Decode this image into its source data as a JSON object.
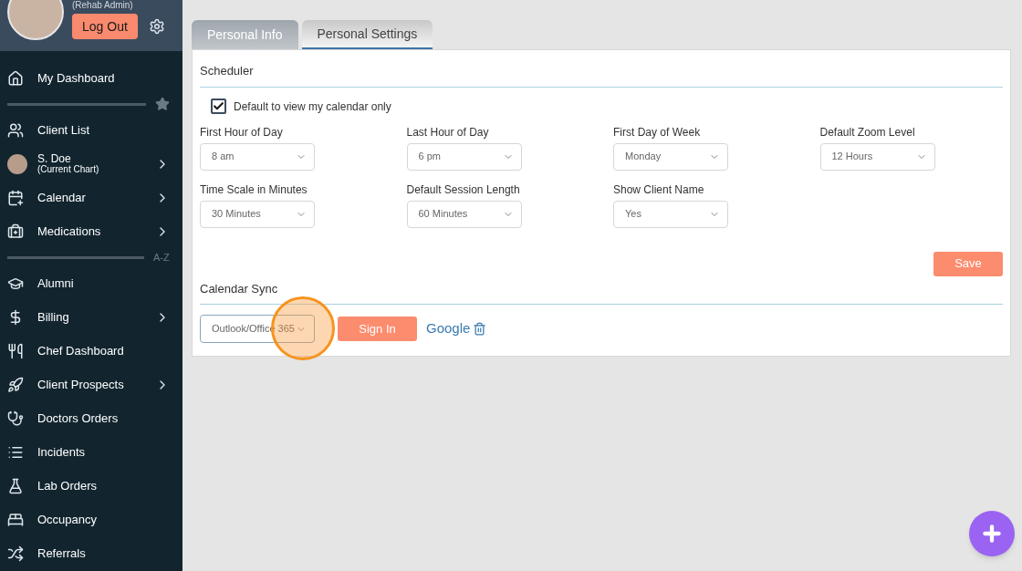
{
  "user": {
    "role": "(Rehab Admin)",
    "logout": "Log Out"
  },
  "sidebar": {
    "items": [
      {
        "kind": "link",
        "label": "My Dashboard",
        "has_submenu": false
      },
      {
        "kind": "divider"
      },
      {
        "kind": "link",
        "label": "Client List",
        "has_submenu": false
      },
      {
        "kind": "chart",
        "label": "S. Doe",
        "subtitle": "(Current Chart)",
        "has_submenu": true
      },
      {
        "kind": "link",
        "label": "Calendar",
        "has_submenu": true
      },
      {
        "kind": "link",
        "label": "Medications",
        "has_submenu": true
      },
      {
        "kind": "divider",
        "label": "A-Z"
      },
      {
        "kind": "link",
        "label": "Alumni",
        "has_submenu": false
      },
      {
        "kind": "link",
        "label": "Billing",
        "has_submenu": true
      },
      {
        "kind": "link",
        "label": "Chef Dashboard",
        "has_submenu": false
      },
      {
        "kind": "link",
        "label": "Client Prospects",
        "has_submenu": true
      },
      {
        "kind": "link",
        "label": "Doctors Orders",
        "has_submenu": false
      },
      {
        "kind": "link",
        "label": "Incidents",
        "has_submenu": false
      },
      {
        "kind": "link",
        "label": "Lab Orders",
        "has_submenu": false
      },
      {
        "kind": "link",
        "label": "Occupancy",
        "has_submenu": false
      },
      {
        "kind": "link",
        "label": "Referrals",
        "has_submenu": false
      }
    ]
  },
  "tabs": [
    {
      "label": "Personal Info",
      "selected": false
    },
    {
      "label": "Personal Settings",
      "selected": true
    }
  ],
  "scheduler": {
    "title": "Scheduler",
    "checkbox": {
      "label": "Default to view my calendar only",
      "checked": true
    },
    "fields": [
      {
        "label": "First Hour of Day",
        "value": "8 am"
      },
      {
        "label": "Last Hour of Day",
        "value": "6 pm"
      },
      {
        "label": "First Day of Week",
        "value": "Monday"
      },
      {
        "label": "Default Zoom Level",
        "value": "12 Hours"
      },
      {
        "label": "Time Scale in Minutes",
        "value": "30 Minutes"
      },
      {
        "label": "Default Session Length",
        "value": "60 Minutes"
      },
      {
        "label": "Show Client Name",
        "value": "Yes"
      }
    ],
    "save": "Save"
  },
  "calendar_sync": {
    "title": "Calendar Sync",
    "provider": "Outlook/Office 365",
    "sign_in": "Sign In",
    "linked": "Google"
  }
}
